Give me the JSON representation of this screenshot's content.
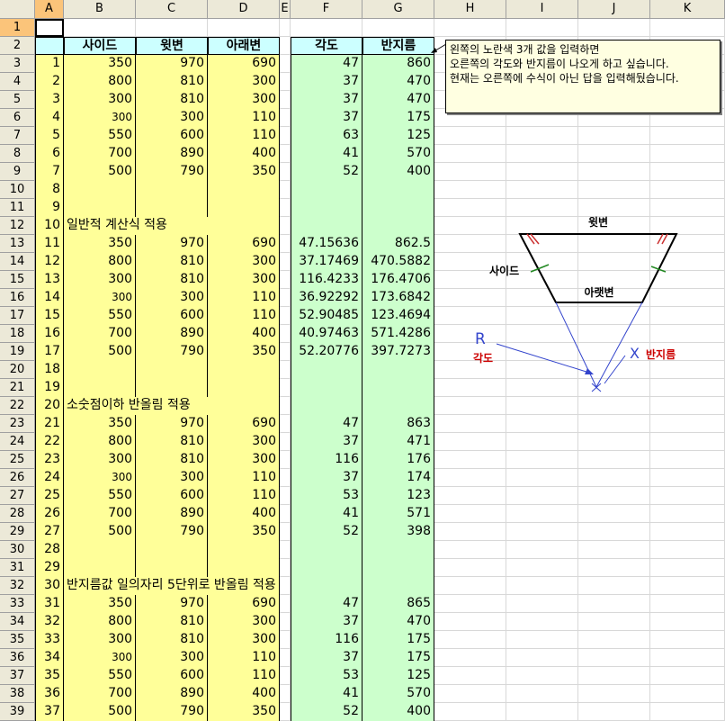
{
  "columns": [
    "A",
    "B",
    "C",
    "D",
    "E",
    "F",
    "G",
    "H",
    "I",
    "J",
    "K"
  ],
  "rows": [
    "1",
    "2",
    "3",
    "4",
    "5",
    "6",
    "7",
    "8",
    "9",
    "10",
    "11",
    "12",
    "13",
    "14",
    "15",
    "16",
    "17",
    "18",
    "19",
    "20",
    "21",
    "22",
    "23",
    "24",
    "25",
    "26",
    "27",
    "28",
    "29",
    "30",
    "31",
    "32",
    "33",
    "34",
    "35",
    "36",
    "37",
    "38",
    "39"
  ],
  "headers": {
    "side": "사이드",
    "top": "윗변",
    "bottom": "아래변",
    "angle": "각도",
    "radius": "반지름"
  },
  "section_labels": {
    "general": "일반적 계산식 적용",
    "round_decimal": "소숫점이하 반올림 적용",
    "round5": "반지름값 일의자리 5단위로 반올림 적용"
  },
  "table": [
    {
      "n": "1",
      "b": "350",
      "c": "970",
      "d": "690",
      "f": "47",
      "g": "860"
    },
    {
      "n": "2",
      "b": "800",
      "c": "810",
      "d": "300",
      "f": "37",
      "g": "470"
    },
    {
      "n": "3",
      "b": "300",
      "c": "810",
      "d": "300",
      "f": "37",
      "g": "470"
    },
    {
      "n": "4",
      "b": "300",
      "c": "300",
      "d": "110",
      "f": "37",
      "g": "175"
    },
    {
      "n": "5",
      "b": "550",
      "c": "600",
      "d": "110",
      "f": "63",
      "g": "125"
    },
    {
      "n": "6",
      "b": "700",
      "c": "890",
      "d": "400",
      "f": "41",
      "g": "570"
    },
    {
      "n": "7",
      "b": "500",
      "c": "790",
      "d": "350",
      "f": "52",
      "g": "400"
    },
    {
      "n": "8",
      "b": "",
      "c": "",
      "d": "",
      "f": "",
      "g": ""
    },
    {
      "n": "9",
      "b": "",
      "c": "",
      "d": "",
      "f": "",
      "g": ""
    },
    {
      "n": "10",
      "b": "",
      "c": "",
      "d": "",
      "f": "",
      "g": ""
    },
    {
      "n": "11",
      "b": "350",
      "c": "970",
      "d": "690",
      "f": "47.15636",
      "g": "862.5"
    },
    {
      "n": "12",
      "b": "800",
      "c": "810",
      "d": "300",
      "f": "37.17469",
      "g": "470.5882"
    },
    {
      "n": "13",
      "b": "300",
      "c": "810",
      "d": "300",
      "f": "116.4233",
      "g": "176.4706"
    },
    {
      "n": "14",
      "b": "300",
      "c": "300",
      "d": "110",
      "f": "36.92292",
      "g": "173.6842"
    },
    {
      "n": "15",
      "b": "550",
      "c": "600",
      "d": "110",
      "f": "52.90485",
      "g": "123.4694"
    },
    {
      "n": "16",
      "b": "700",
      "c": "890",
      "d": "400",
      "f": "40.97463",
      "g": "571.4286"
    },
    {
      "n": "17",
      "b": "500",
      "c": "790",
      "d": "350",
      "f": "52.20776",
      "g": "397.7273"
    },
    {
      "n": "18",
      "b": "",
      "c": "",
      "d": "",
      "f": "",
      "g": ""
    },
    {
      "n": "19",
      "b": "",
      "c": "",
      "d": "",
      "f": "",
      "g": ""
    },
    {
      "n": "20",
      "b": "",
      "c": "",
      "d": "",
      "f": "",
      "g": ""
    },
    {
      "n": "21",
      "b": "350",
      "c": "970",
      "d": "690",
      "f": "47",
      "g": "863"
    },
    {
      "n": "22",
      "b": "800",
      "c": "810",
      "d": "300",
      "f": "37",
      "g": "471"
    },
    {
      "n": "23",
      "b": "300",
      "c": "810",
      "d": "300",
      "f": "116",
      "g": "176"
    },
    {
      "n": "24",
      "b": "300",
      "c": "300",
      "d": "110",
      "f": "37",
      "g": "174"
    },
    {
      "n": "25",
      "b": "550",
      "c": "600",
      "d": "110",
      "f": "53",
      "g": "123"
    },
    {
      "n": "26",
      "b": "700",
      "c": "890",
      "d": "400",
      "f": "41",
      "g": "571"
    },
    {
      "n": "27",
      "b": "500",
      "c": "790",
      "d": "350",
      "f": "52",
      "g": "398"
    },
    {
      "n": "28",
      "b": "",
      "c": "",
      "d": "",
      "f": "",
      "g": ""
    },
    {
      "n": "29",
      "b": "",
      "c": "",
      "d": "",
      "f": "",
      "g": ""
    },
    {
      "n": "30",
      "b": "",
      "c": "",
      "d": "",
      "f": "",
      "g": ""
    },
    {
      "n": "31",
      "b": "350",
      "c": "970",
      "d": "690",
      "f": "47",
      "g": "865"
    },
    {
      "n": "32",
      "b": "800",
      "c": "810",
      "d": "300",
      "f": "37",
      "g": "470"
    },
    {
      "n": "33",
      "b": "300",
      "c": "810",
      "d": "300",
      "f": "116",
      "g": "175"
    },
    {
      "n": "34",
      "b": "300",
      "c": "300",
      "d": "110",
      "f": "37",
      "g": "175"
    },
    {
      "n": "35",
      "b": "550",
      "c": "600",
      "d": "110",
      "f": "53",
      "g": "125"
    },
    {
      "n": "36",
      "b": "700",
      "c": "890",
      "d": "400",
      "f": "41",
      "g": "570"
    },
    {
      "n": "37",
      "b": "500",
      "c": "790",
      "d": "350",
      "f": "52",
      "g": "400"
    }
  ],
  "comment": {
    "line1": "왼쪽의 노란색 3개 값을 입력하면",
    "line2": "오른쪽의 각도와 반지름이 나오게 하고 싶습니다.",
    "line3": "현재는 오른쪽에 수식이 아닌 답을 입력해뒀습니다."
  },
  "diagram": {
    "top_label": "윗변",
    "side_label": "사이드",
    "bottom_label": "아랫변",
    "r_label": "R",
    "angle_label": "각도",
    "x_label": "X",
    "radius_label": "반지름"
  },
  "colors": {
    "yellow": "#ffff99",
    "green": "#ccffcc",
    "cyan": "#ccffff",
    "header_bg": "#ece9d8",
    "selected_header": "#fbc47a",
    "blue": "#3344cc",
    "red": "#cc0000"
  }
}
